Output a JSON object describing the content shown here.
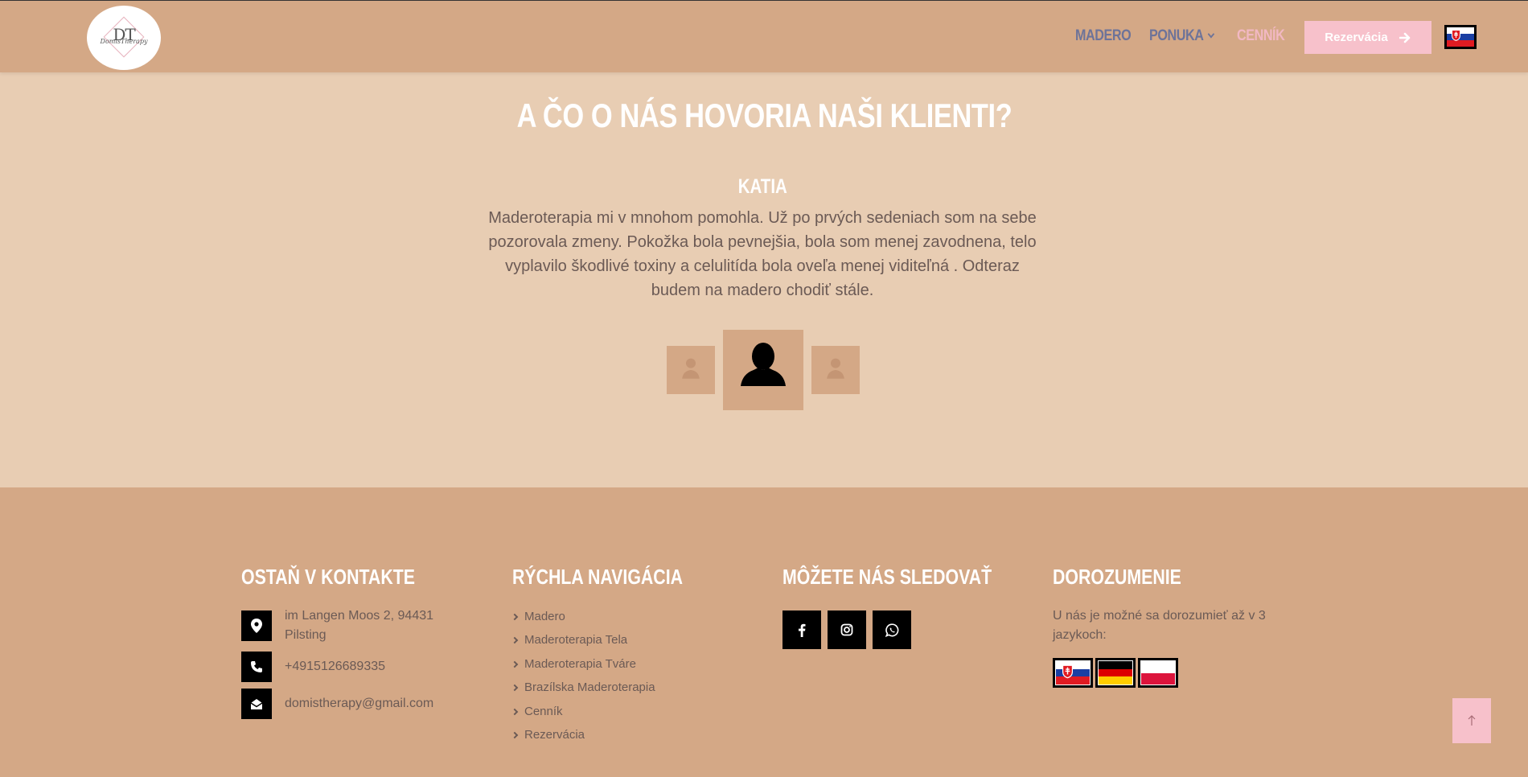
{
  "header": {
    "logo_text": "DT",
    "logo_script": "DomisTherapy",
    "nav": {
      "madero": "MADERO",
      "ponuka": "PONUKA",
      "cennik": "CENNÍK"
    },
    "reservation_button": "Rezervácia",
    "language_icon": "slovak-flag-icon"
  },
  "testimonials": {
    "title": "A ČO O NÁS HOVORIA NAŠI KLIENTI?",
    "active": {
      "name": "KATIA",
      "text": "Maderoterapia mi v mnohom pomohla. Už po prvých sedeniach som na sebe pozorovala zmeny. Pokožka bola pevnejšia, bola som menej zavodnena, telo vyplavilo škodlivé toxiny a celulitída bola oveľa menej viditeľná . Odteraz budem na madero chodiť stále."
    },
    "avatar_icon": "user-silhouette-icon"
  },
  "footer": {
    "contact": {
      "heading": "OSTAŇ V KONTAKTE",
      "address": "im Langen Moos 2, 94431 Pilsting",
      "phone": "+4915126689335",
      "email": "domistherapy@gmail.com",
      "icons": [
        "location-pin-icon",
        "phone-icon",
        "envelope-open-icon"
      ]
    },
    "quick_nav": {
      "heading": "RÝCHLA NAVIGÁCIA",
      "links": [
        "Madero",
        "Maderoterapia Tela",
        "Maderoterapia Tváre",
        "Brazílska Maderoterapia",
        "Cenník",
        "Rezervácia"
      ]
    },
    "follow": {
      "heading": "MÔŽETE NÁS SLEDOVAŤ",
      "icons": [
        "facebook-icon",
        "instagram-icon",
        "whatsapp-icon"
      ]
    },
    "languages": {
      "heading": "DOROZUMENIE",
      "text": "U nás je možné sa dorozumieť až v 3 jazykoch:",
      "flags": [
        "slovak-flag-icon",
        "german-flag-icon",
        "polish-flag-icon"
      ]
    }
  },
  "scroll_top_icon": "arrow-up-icon",
  "colors": {
    "header_bg": "#d4a886",
    "page_bg": "#e8cdb3",
    "accent_pink": "#f7c1cb",
    "nav_blue": "#6d7399",
    "body_text": "#6b5a55"
  }
}
